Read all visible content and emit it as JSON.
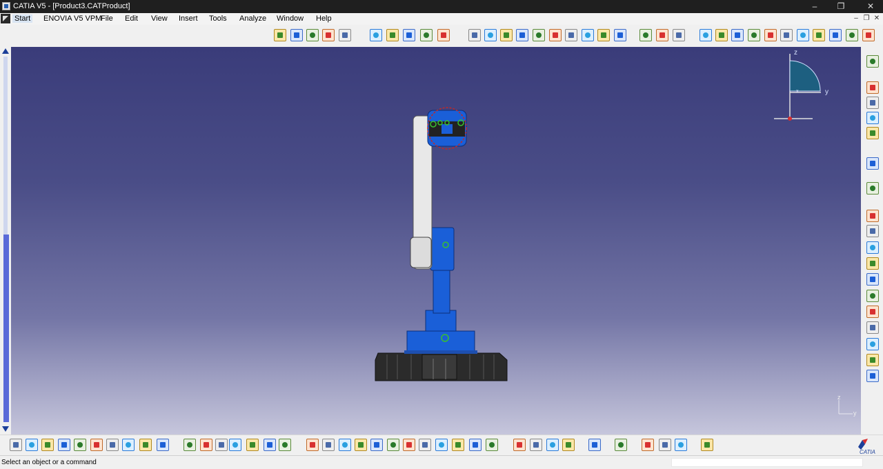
{
  "window": {
    "title": "CATIA V5 - [Product3.CATProduct]",
    "controls": {
      "minimize": "–",
      "restore": "❐",
      "close": "✕"
    }
  },
  "menu": {
    "items": [
      "Start",
      "ENOVIA V5 VPM",
      "File",
      "Edit",
      "View",
      "Insert",
      "Tools",
      "Analyze",
      "Window",
      "Help"
    ],
    "doc_controls": {
      "minimize": "–",
      "restore": "❐",
      "close": "✕"
    }
  },
  "toolbars": {
    "top_icons": [
      "assembly-icon",
      "new-component-icon",
      "new-product-icon",
      "new-part-icon",
      "existing-component-icon",
      "measure-between-icon",
      "annotation-text-icon",
      "flag-note-icon",
      "snap-icon",
      "manipulate-icon",
      "constraint-coincidence-icon",
      "constraint-contact-icon",
      "constraint-offset-icon",
      "constraint-angle-icon",
      "fix-component-icon",
      "fix-together-icon",
      "quick-constraint-icon",
      "update-icon",
      "reuse-pattern-icon",
      "catalog-browser-icon",
      "explode-icon",
      "clash-icon",
      "sectioning-icon",
      "isometric-view-icon",
      "front-view-icon",
      "back-view-icon",
      "left-view-icon",
      "right-view-icon",
      "top-view-icon",
      "bottom-view-icon",
      "render-style-icon",
      "apply-material-icon",
      "more-commands-icon",
      "knowledge-icon"
    ],
    "right_icons": [
      "bill-of-material-icon",
      "scenes-icon",
      "enhanced-scene-icon",
      "save-management-icon",
      "select-icon",
      "tools-palette-icon",
      "component-catalog-icon",
      "generate-numbering-icon",
      "product-init-icon",
      "publication-icon",
      "edit-link-icon",
      "replace-component-icon",
      "graph-tree-icon",
      "reorder-icon",
      "multi-instantiation-icon",
      "fast-multi-instantiation-icon",
      "define-multi-instantiation-icon",
      "apply-material-2-icon"
    ],
    "bottom_icons": [
      "new-icon",
      "open-icon",
      "save-icon",
      "print-icon",
      "cut-icon",
      "copy-icon",
      "paste-icon",
      "undo-icon",
      "redo-icon",
      "whats-this-icon",
      "formula-icon",
      "comment-icon",
      "arrow-icon",
      "table-icon",
      "design-table-icon",
      "law-icon",
      "axis-system-icon",
      "fly-mode-icon",
      "fit-all-icon",
      "pan-icon",
      "rotate-icon",
      "zoom-in-icon",
      "zoom-out-icon",
      "normal-view-icon",
      "multi-view-icon",
      "quick-view-icon",
      "view-mode-icon",
      "hide-show-icon",
      "swap-visible-space-icon",
      "create-multi-view-icon",
      "transform-icon",
      "capture-icon",
      "image-icon",
      "compass-icon",
      "graph-icon",
      "hide-icon",
      "refresh-icon",
      "selection-sets-icon",
      "grid-icon"
    ]
  },
  "viewport": {
    "compass_axes": {
      "z": "z",
      "y": "y",
      "x": "x"
    },
    "corner_axes": {
      "z": "z",
      "y": "y"
    }
  },
  "status": {
    "message": "Select an object or a command",
    "command_value": ""
  },
  "brand": {
    "logo_text": "CATIA"
  },
  "colors": {
    "accent": "#1c3f99",
    "part_blue": "#1a5fd8",
    "part_white": "#e8e8e8",
    "base_dark": "#2b2b2b"
  }
}
